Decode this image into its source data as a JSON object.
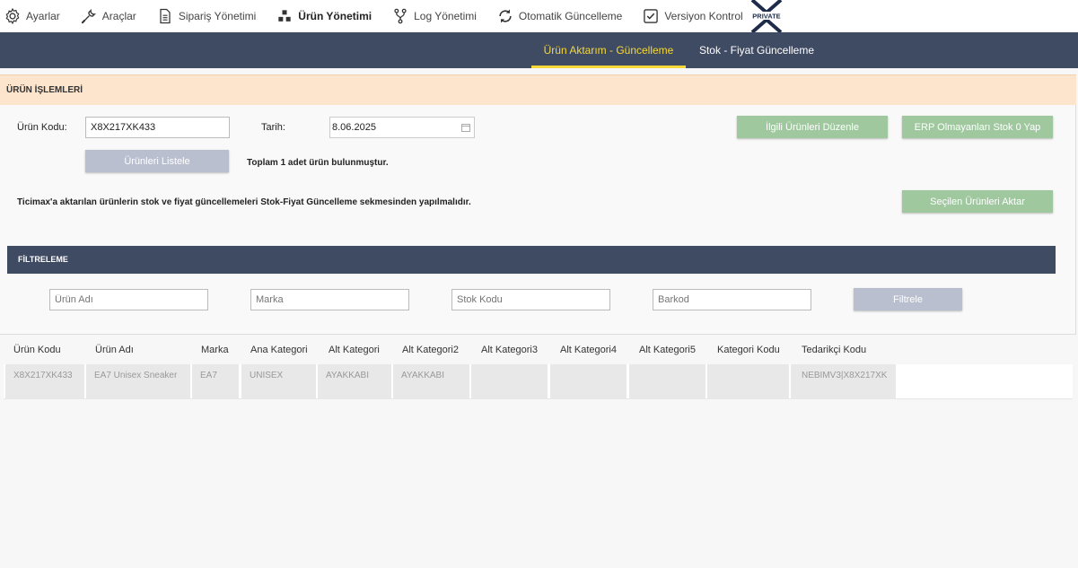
{
  "menu": {
    "items": [
      {
        "label": "Ayarlar",
        "icon": "gear-icon"
      },
      {
        "label": "Araçlar",
        "icon": "wrench-icon"
      },
      {
        "label": "Sipariş Yönetimi",
        "icon": "document-icon"
      },
      {
        "label": "Ürün Yönetimi",
        "icon": "boxes-icon"
      },
      {
        "label": "Log Yönetimi",
        "icon": "branch-icon"
      },
      {
        "label": "Otomatik Güncelleme",
        "icon": "refresh-icon"
      },
      {
        "label": "Versiyon Kontrol",
        "icon": "checkbox-icon"
      }
    ],
    "active_index": 3,
    "logo_text": "PRIVATE"
  },
  "tabs": [
    {
      "label": "Ürün Aktarım - Güncelleme",
      "active": true
    },
    {
      "label": "Stok - Fiyat Güncelleme",
      "active": false
    }
  ],
  "urun_islemleri": {
    "title": "ÜRÜN İŞLEMLERİ",
    "urun_kodu_label": "Ürün Kodu:",
    "urun_kodu_value": "X8X217XK433",
    "tarih_label": "Tarih:",
    "tarih_value": "8.06.2025",
    "list_button": "Ürünleri Listele",
    "result_text": "Toplam 1 adet ürün bulunmuştur.",
    "info_text": "Ticimax'a aktarılan ürünlerin stok ve fiyat güncellemeleri Stok-Fiyat Güncelleme sekmesinden yapılmalıdır.",
    "edit_button": "İlgili Ürünleri Düzenle",
    "erp_button": "ERP Olmayanları Stok 0 Yap",
    "transfer_button": "Seçilen Ürünleri Aktar"
  },
  "filter": {
    "title": "FİLTRELEME",
    "placeholders": {
      "urun_adi": "Ürün Adı",
      "marka": "Marka",
      "stok_kodu": "Stok Kodu",
      "barkod": "Barkod"
    },
    "button": "Filtrele"
  },
  "table": {
    "headers": [
      "Ürün Kodu",
      "Ürün Adı",
      "Marka",
      "Ana Kategori",
      "Alt Kategori",
      "Alt Kategori2",
      "Alt Kategori3",
      "Alt Kategori4",
      "Alt Kategori5",
      "Kategori Kodu",
      "Tedarikçi Kodu"
    ],
    "rows": [
      [
        "X8X217XK433",
        "EA7 Unisex Sneaker",
        "EA7",
        "UNISEX",
        "AYAKKABI",
        "AYAKKABI",
        "",
        "",
        "",
        "",
        "NEBIMV3|X8X217XK"
      ]
    ]
  },
  "colors": {
    "navbar": "#3f4a63",
    "active_tab": "#f5d838",
    "section_head": "#fde4cd",
    "green_button": "#9fc89f",
    "gray_button": "#b9bfce"
  }
}
